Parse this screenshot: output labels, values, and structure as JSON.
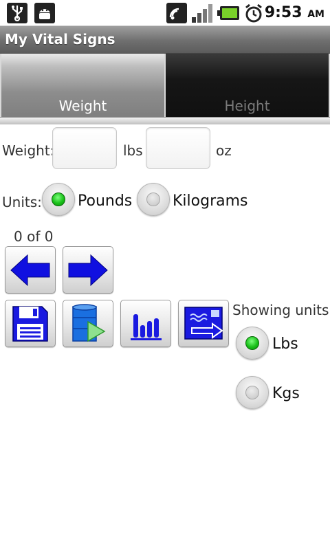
{
  "status_bar": {
    "time": "9:53",
    "ampm": "AM",
    "icons": [
      "usb-icon",
      "android-debug-icon",
      "wifi-icon",
      "signal-icon",
      "battery-icon",
      "alarm-clock-icon"
    ]
  },
  "app": {
    "title": "My Vital Signs"
  },
  "tabs": [
    {
      "label": "Weight",
      "selected": true
    },
    {
      "label": "Height",
      "selected": false
    }
  ],
  "weight_form": {
    "weight_label": "Weight:",
    "lbs_value": "",
    "lbs_unit": "lbs",
    "oz_value": "",
    "oz_unit": "oz"
  },
  "units": {
    "label": "Units:",
    "options": [
      {
        "label": "Pounds",
        "checked": true
      },
      {
        "label": "Kilograms",
        "checked": false
      }
    ]
  },
  "record_counter": "0 of 0",
  "buttons": {
    "prev": "arrow-left-icon",
    "next": "arrow-right-icon",
    "save": "floppy-disk-icon",
    "database": "database-icon",
    "chart": "bar-chart-icon",
    "export": "export-icon"
  },
  "showing_units": {
    "label": "Showing units",
    "options": [
      {
        "label": "Lbs",
        "checked": true
      },
      {
        "label": "Kgs",
        "checked": false
      }
    ]
  },
  "colors": {
    "accent_blue": "#1010e0",
    "radio_green": "#19c019",
    "titlebar": "#6f6f6f"
  }
}
